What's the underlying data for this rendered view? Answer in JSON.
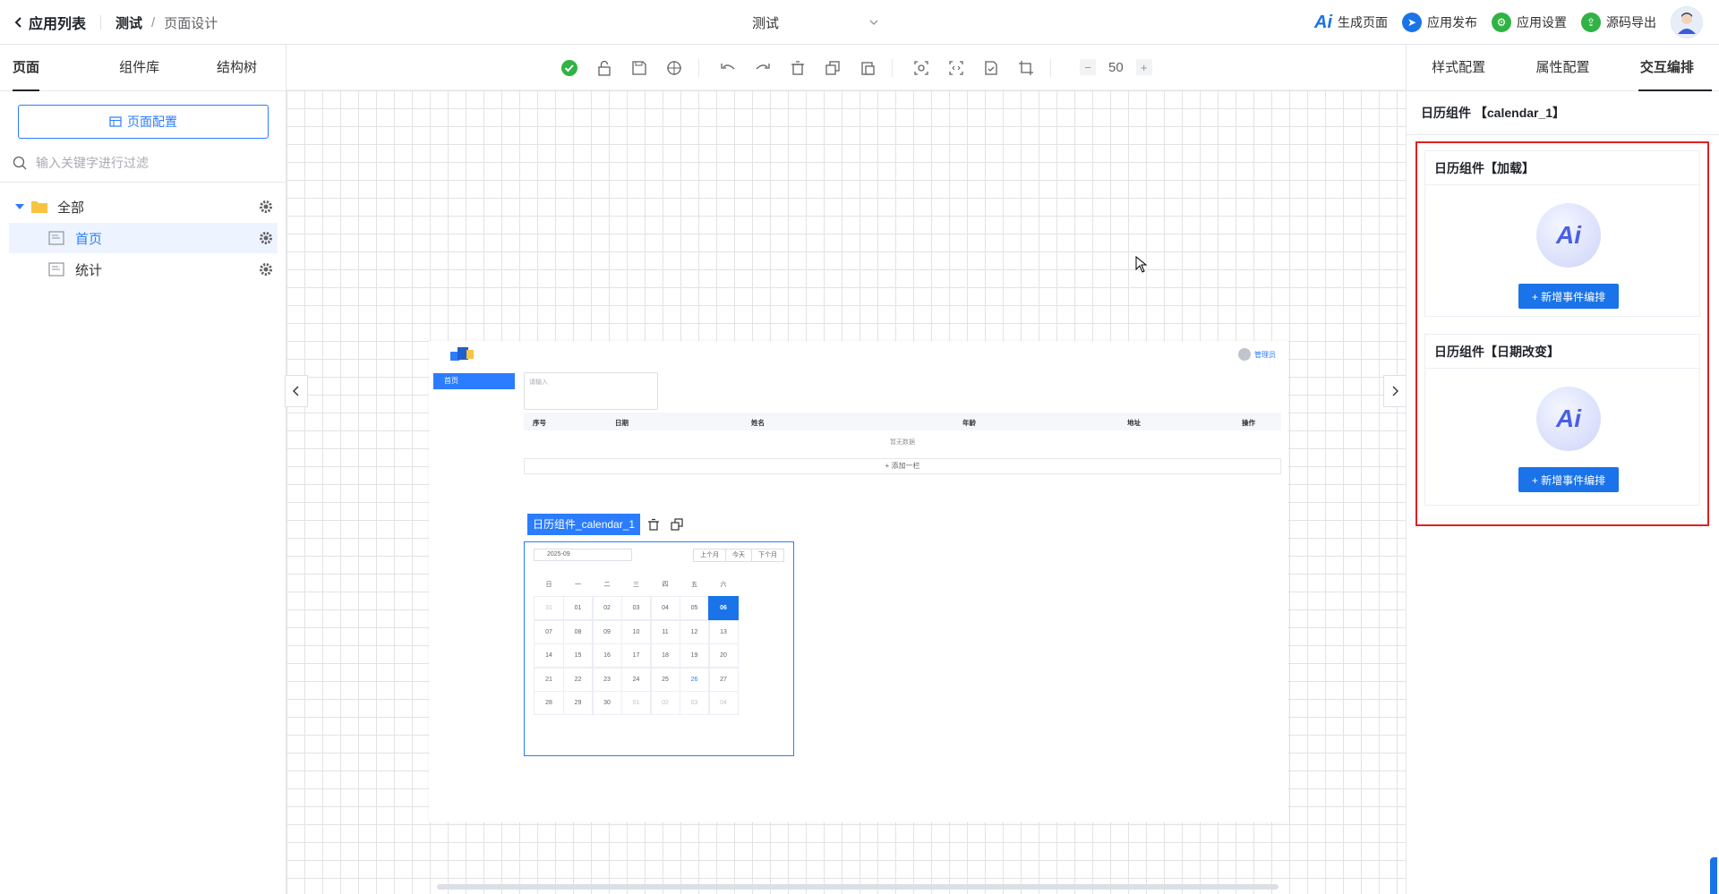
{
  "topbar": {
    "back_label": "应用列表",
    "breadcrumb_app": "测试",
    "breadcrumb_sep": "/",
    "breadcrumb_page": "页面设计",
    "center_app": "测试",
    "actions": [
      {
        "label": "生成页面",
        "icon": "ai-icon",
        "color": "#1a73e8"
      },
      {
        "label": "应用发布",
        "icon": "send-icon",
        "color": "#1a73e8"
      },
      {
        "label": "应用设置",
        "icon": "settings-icon",
        "color": "#2fb344"
      },
      {
        "label": "源码导出",
        "icon": "export-icon",
        "color": "#2fb344"
      }
    ]
  },
  "left": {
    "tabs": [
      "页面",
      "组件库",
      "结构树"
    ],
    "active_tab": "页面",
    "page_config_label": "页面配置",
    "search_placeholder": "输入关键字进行过滤",
    "tree": [
      {
        "label": "全部",
        "type": "folder"
      },
      {
        "label": "首页",
        "type": "page",
        "selected": true
      },
      {
        "label": "统计",
        "type": "page"
      }
    ]
  },
  "toolbar": {
    "zoom": "50"
  },
  "preview": {
    "user": "管理员",
    "menu_item": "首页",
    "input_placeholder": "请输入",
    "table_headers": [
      "序号",
      "日期",
      "姓名",
      "年龄",
      "地址",
      "操作"
    ],
    "empty_text": "暂无数据",
    "add_column": "+ 添加一栏",
    "component_label": "日历组件_calendar_1",
    "calendar": {
      "month": "2025-09",
      "buttons": [
        "上个月",
        "今天",
        "下个月"
      ],
      "weekdays": [
        "日",
        "一",
        "二",
        "三",
        "四",
        "五",
        "六"
      ],
      "days": [
        [
          "31",
          "01",
          "02",
          "03",
          "04",
          "05",
          "06"
        ],
        [
          "07",
          "08",
          "09",
          "10",
          "11",
          "12",
          "13"
        ],
        [
          "14",
          "15",
          "16",
          "17",
          "18",
          "19",
          "20"
        ],
        [
          "21",
          "22",
          "23",
          "24",
          "25",
          "26",
          "27"
        ],
        [
          "28",
          "29",
          "30",
          "01",
          "02",
          "03",
          "04"
        ]
      ],
      "selected": "06",
      "today": "26"
    }
  },
  "right": {
    "tabs": [
      "样式配置",
      "属性配置",
      "交互编排"
    ],
    "active_tab": "交互编排",
    "title": "日历组件 【calendar_1】",
    "events": [
      {
        "title": "日历组件【加载】",
        "button": "+ 新增事件编排"
      },
      {
        "title": "日历组件【日期改变】",
        "button": "+ 新增事件编排"
      }
    ]
  }
}
